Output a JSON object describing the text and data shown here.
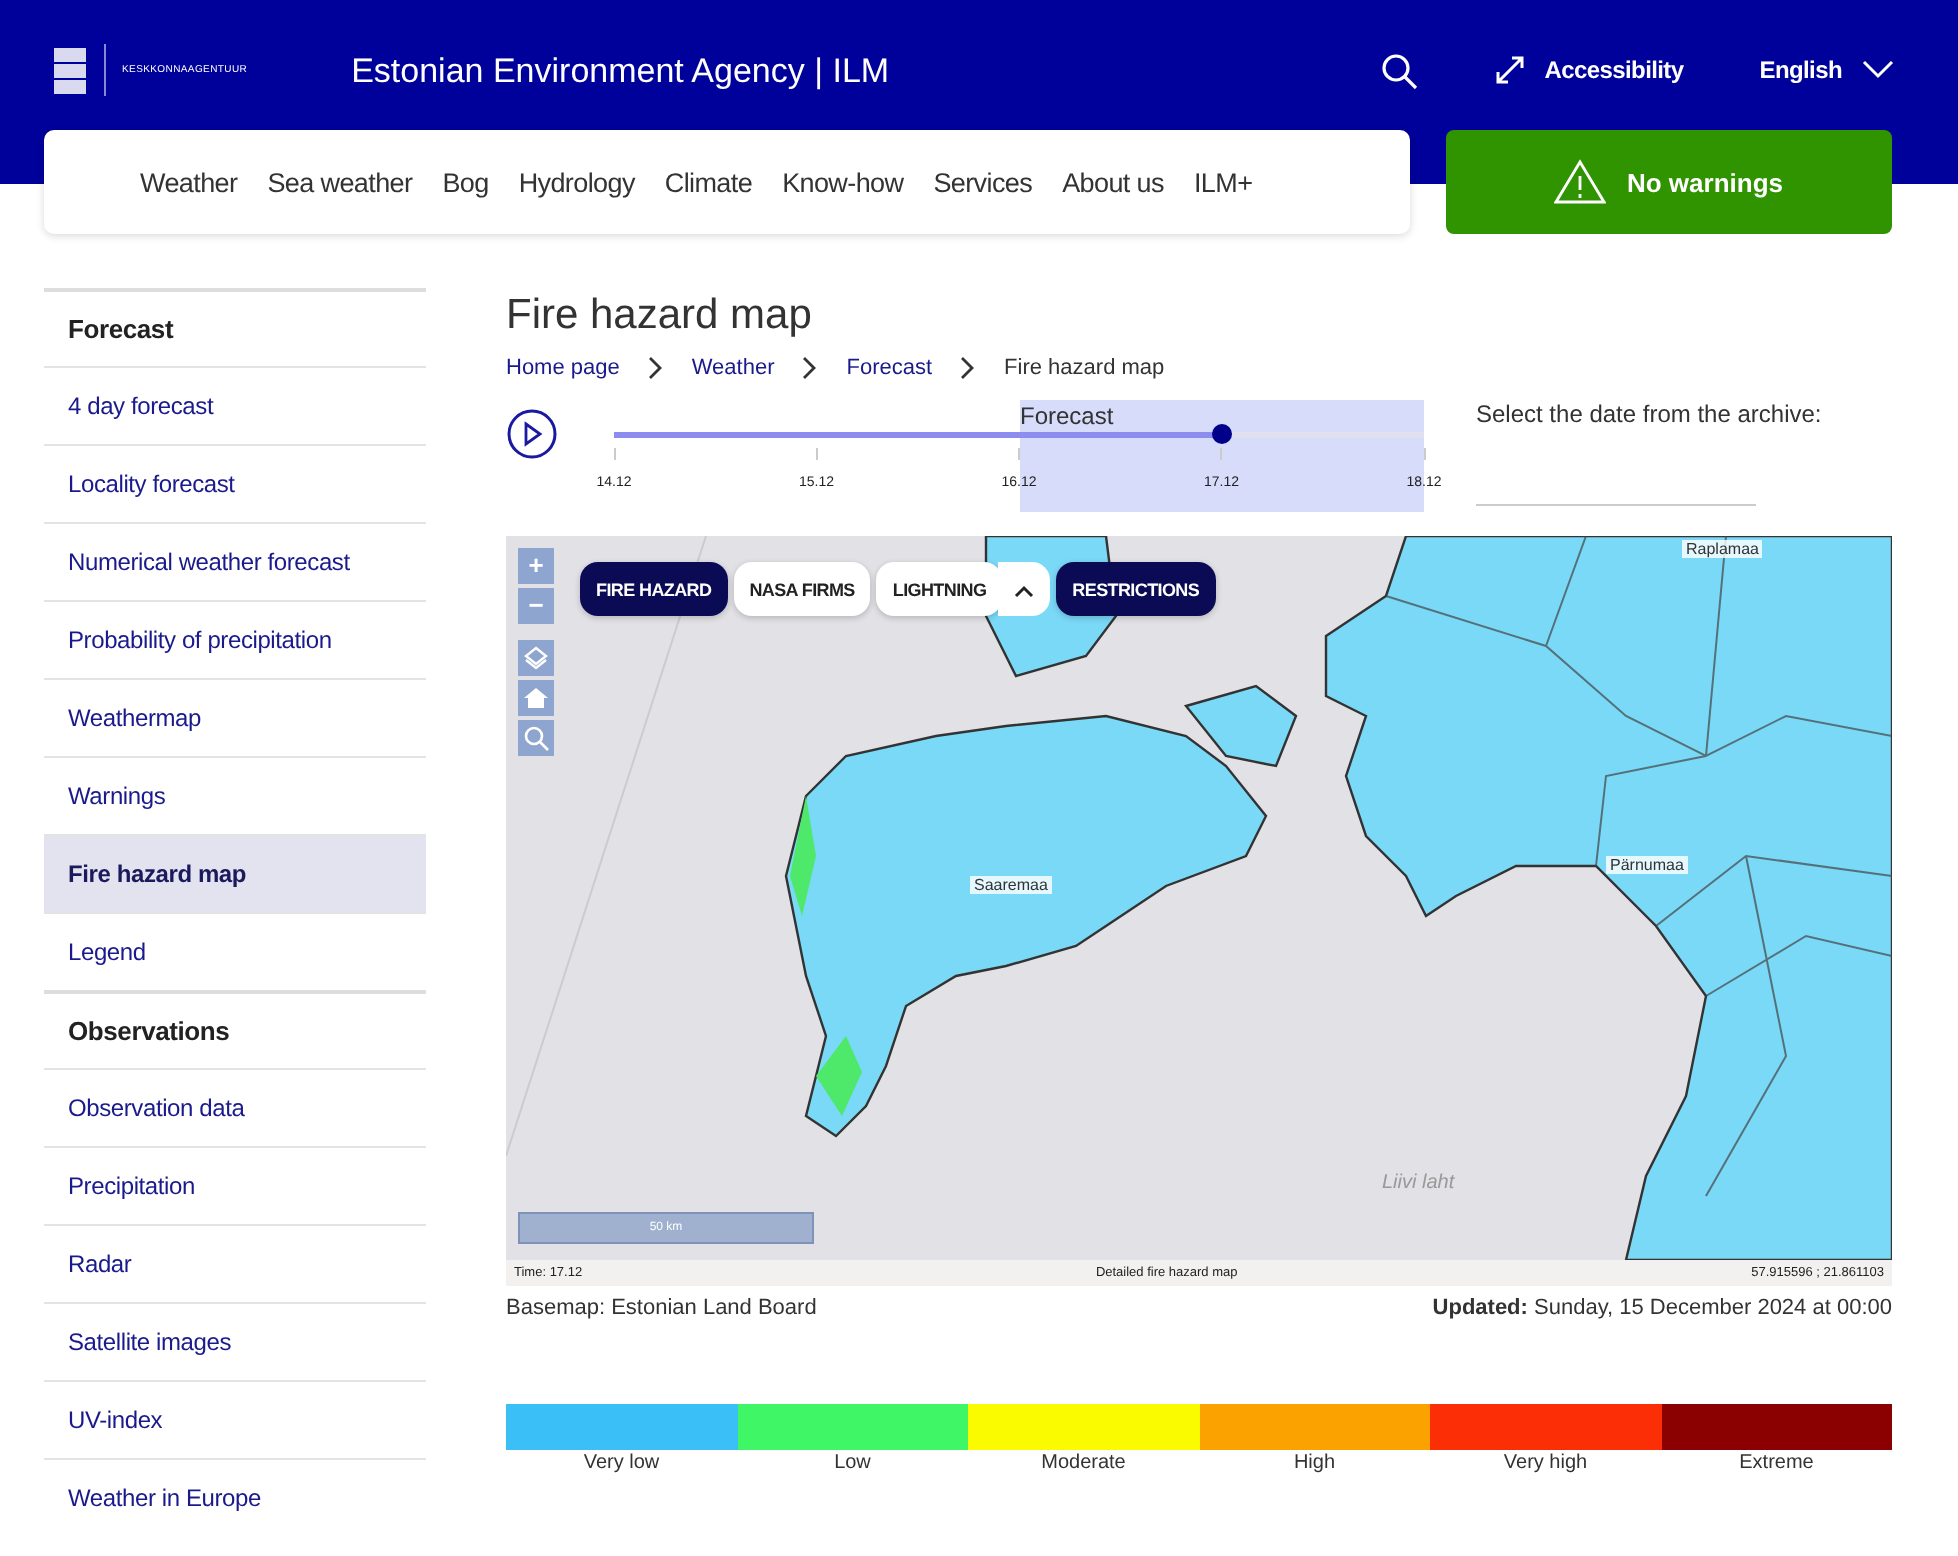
{
  "header": {
    "logo_text": "KESKKONNAAGENTUUR",
    "title": "Estonian Environment Agency | ILM",
    "accessibility": "Accessibility",
    "language": "English"
  },
  "nav": [
    "Weather",
    "Sea weather",
    "Bog",
    "Hydrology",
    "Climate",
    "Know-how",
    "Services",
    "About us",
    "ILM+"
  ],
  "warnings": {
    "label": "No warnings"
  },
  "sidebar": [
    {
      "heading": "Forecast",
      "items": [
        {
          "label": "4 day forecast",
          "selected": false
        },
        {
          "label": "Locality forecast",
          "selected": false
        },
        {
          "label": "Numerical weather forecast",
          "selected": false
        },
        {
          "label": "Probability of precipitation",
          "selected": false
        },
        {
          "label": "Weathermap",
          "selected": false
        },
        {
          "label": "Warnings",
          "selected": false
        },
        {
          "label": "Fire hazard map",
          "selected": true
        },
        {
          "label": "Legend",
          "selected": false
        }
      ]
    },
    {
      "heading": "Observations",
      "items": [
        {
          "label": "Observation data",
          "selected": false
        },
        {
          "label": "Precipitation",
          "selected": false
        },
        {
          "label": "Radar",
          "selected": false
        },
        {
          "label": "Satellite images",
          "selected": false
        },
        {
          "label": "UV-index",
          "selected": false
        },
        {
          "label": "Weather in Europe",
          "selected": false
        }
      ]
    }
  ],
  "page_title": "Fire hazard map",
  "breadcrumbs": [
    "Home page",
    "Weather",
    "Forecast",
    "Fire hazard map"
  ],
  "timeline": {
    "forecast_label": "Forecast",
    "level": 0.75,
    "ticks": [
      "14.12",
      "15.12",
      "16.12",
      "17.12",
      "18.12"
    ]
  },
  "archive": {
    "label": "Select the date from the archive:"
  },
  "map": {
    "layers": [
      {
        "label": "FIRE HAZARD",
        "selected": true
      },
      {
        "label": "NASA FIRMS",
        "selected": false
      },
      {
        "label": "LIGHTNING",
        "selected": false
      },
      {
        "label": "RESTRICTIONS",
        "selected": true
      }
    ],
    "controls": {
      "zoom_in": "+",
      "zoom_out": "−"
    },
    "places": [
      {
        "name": "Saaremaa",
        "kind": "county"
      },
      {
        "name": "Pärnumaa",
        "kind": "county"
      },
      {
        "name": "Raplamaa",
        "kind": "county"
      },
      {
        "name": "Liivi laht",
        "kind": "water"
      }
    ],
    "scale": "50 km",
    "footer": {
      "time": "Time: 17.12",
      "caption": "Detailed fire hazard map",
      "coordinates": "57.915596 ; 21.861103"
    }
  },
  "basemap": "Basemap: Estonian Land Board",
  "updated": {
    "label": "Updated:",
    "value": "Sunday, 15 December 2024 at 00:00"
  },
  "legend": [
    {
      "label": "Very low",
      "color": "#3bbff7"
    },
    {
      "label": "Low",
      "color": "#3ff766"
    },
    {
      "label": "Moderate",
      "color": "#fbfb00"
    },
    {
      "label": "High",
      "color": "#fba200"
    },
    {
      "label": "Very high",
      "color": "#fb2e05"
    },
    {
      "label": "Extreme",
      "color": "#8b0000"
    }
  ]
}
